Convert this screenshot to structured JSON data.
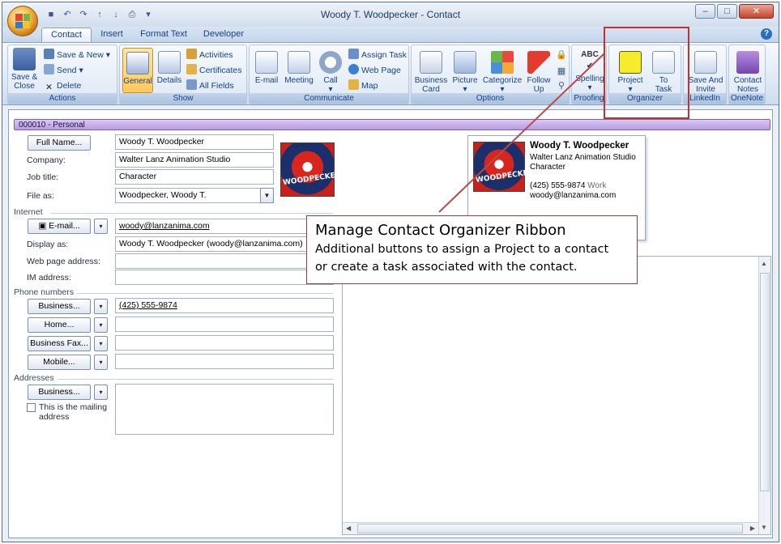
{
  "window": {
    "title": "Woody T. Woodpecker - Contact",
    "qat_icons": [
      "save-icon",
      "undo-icon",
      "redo-icon",
      "up-arrow-icon",
      "down-arrow-icon",
      "print-icon",
      "customize-icon"
    ],
    "buttons": {
      "minimize": "–",
      "maximize": "□",
      "close": "✕"
    }
  },
  "tabs": [
    "Contact",
    "Insert",
    "Format Text",
    "Developer"
  ],
  "help_label": "?",
  "ribbon": {
    "actions": {
      "label": "Actions",
      "save_close_1": "Save &",
      "save_close_2": "Close",
      "save_new": "Save & New",
      "send": "Send",
      "delete": "Delete"
    },
    "show": {
      "label": "Show",
      "general": "General",
      "details": "Details",
      "activities": "Activities",
      "certificates": "Certificates",
      "all_fields": "All Fields"
    },
    "communicate": {
      "label": "Communicate",
      "email": "E-mail",
      "meeting": "Meeting",
      "call": "Call",
      "assign_task": "Assign Task",
      "web_page": "Web Page",
      "map": "Map"
    },
    "options": {
      "label": "Options",
      "business_card_1": "Business",
      "business_card_2": "Card",
      "picture": "Picture",
      "categorize": "Categorize",
      "follow_up_1": "Follow",
      "follow_up_2": "Up"
    },
    "proofing": {
      "label": "Proofing",
      "spelling": "Spelling"
    },
    "organizer": {
      "label": "Organizer",
      "project": "Project",
      "to_task_1": "To",
      "to_task_2": "Task"
    },
    "linkedin": {
      "label": "LinkedIn",
      "save_invite_1": "Save And",
      "save_invite_2": "Invite"
    },
    "onenote": {
      "label": "OneNote",
      "contact_notes_1": "Contact",
      "contact_notes_2": "Notes"
    }
  },
  "contact": {
    "header": "000010 - Personal",
    "full_name_button": "Full Name...",
    "full_name": "Woody T. Woodpecker",
    "company_label": "Company:",
    "company": "Walter Lanz Animation Studio",
    "job_title_label": "Job title:",
    "job_title": "Character",
    "file_as_label": "File as:",
    "file_as": "Woodpecker, Woody T.",
    "internet_label": "Internet",
    "email_button": "E-mail...",
    "email": "woody@lanzanima.com",
    "display_as_label": "Display as:",
    "display_as": "Woody T. Woodpecker (woody@lanzanima.com)",
    "web_page_label": "Web page address:",
    "im_label": "IM address:",
    "phone_label": "Phone numbers",
    "phones": [
      {
        "button": "Business...",
        "value": "(425) 555-9874"
      },
      {
        "button": "Home...",
        "value": ""
      },
      {
        "button": "Business Fax...",
        "value": ""
      },
      {
        "button": "Mobile...",
        "value": ""
      }
    ],
    "addresses_label": "Addresses",
    "address_button": "Business...",
    "mailing_1": "This is the mailing",
    "mailing_2": "address",
    "photo_text": "WOODPECKER"
  },
  "card": {
    "name": "Woody T. Woodpecker",
    "company": "Walter Lanz Animation Studio",
    "title": "Character",
    "phone": "(425) 555-9874",
    "phone_tag": "Work",
    "email": "woody@lanzanima.com"
  },
  "callout": {
    "title": "Manage Contact Organizer Ribbon",
    "line1": "Additional buttons to assign a Project to a contact",
    "line2": "or create a task associated with the contact."
  },
  "colors": {
    "accent": "#15428b",
    "highlight": "#c9302c",
    "header": "#b79ce3"
  }
}
